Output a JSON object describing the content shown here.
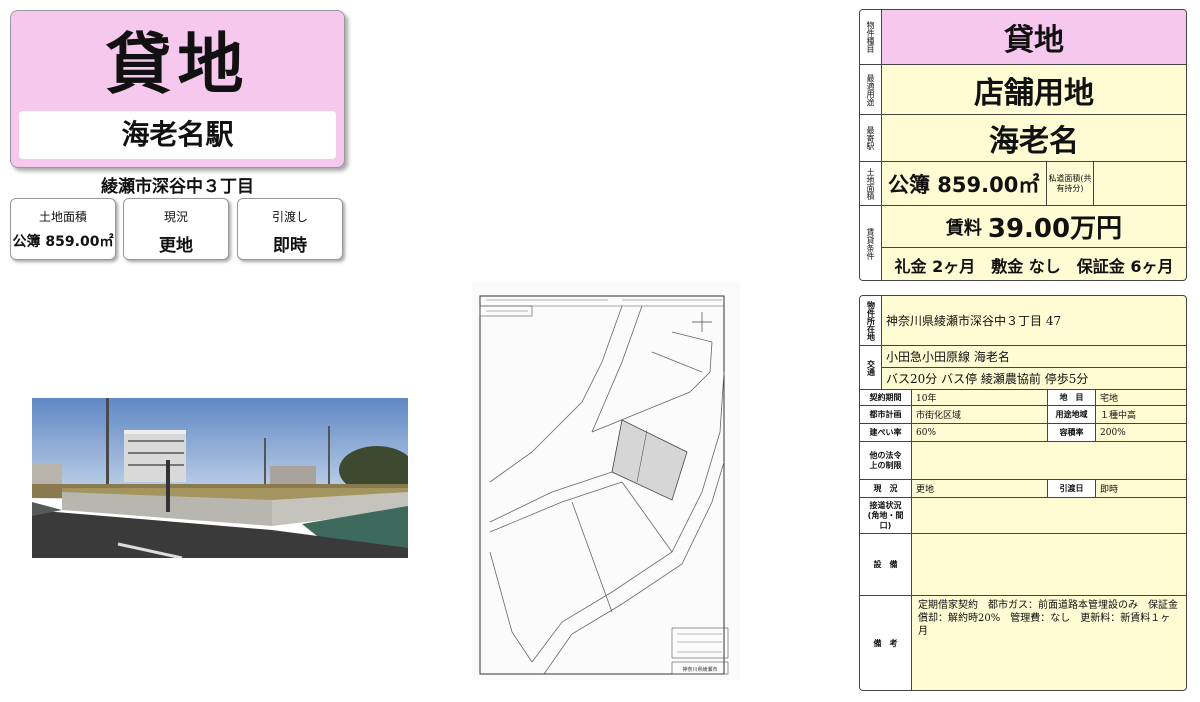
{
  "left": {
    "title": "貸地",
    "station": "海老名駅",
    "address": "綾瀬市深谷中３丁目",
    "boxes": [
      {
        "label": "土地面積",
        "value": "公簿 859.00㎡"
      },
      {
        "label": "現況",
        "value": "更地"
      },
      {
        "label": "引渡し",
        "value": "即時"
      }
    ]
  },
  "right_top": {
    "type_label": "物件種目",
    "type_value": "貸地",
    "use_label": "最適用途",
    "use_value": "店舗用地",
    "station_label": "最寄駅",
    "station_value": "海老名",
    "area_label": "土地面積",
    "area_value": "公簿 859.00㎡",
    "private_road_label": "私道面積(共有持分)",
    "terms_label": "賃貸条件",
    "rent_label": "賃料",
    "rent_value": "39.00万円",
    "fees": "礼金 2ヶ月　敷金 なし　保証金 6ヶ月"
  },
  "right_bottom": {
    "location_label": "物件所在地",
    "location_value": "神奈川県綾瀬市深谷中３丁目 47",
    "transport_label": "交通",
    "transport_line1": "小田急小田原線 海老名",
    "transport_line2": "バス20分 バス停 綾瀬農協前 停歩5分",
    "contract_label": "契約期間",
    "contract_value": "10年",
    "land_cat_label": "地　目",
    "land_cat_value": "宅地",
    "planning_label": "都市計画",
    "planning_value": "市街化区域",
    "zone_label": "用途地域",
    "zone_value": "１種中高",
    "coverage_label": "建ぺい率",
    "coverage_value": "60%",
    "far_label": "容積率",
    "far_value": "200%",
    "legal_label": "他の法令上の制限",
    "legal_value": "",
    "status_label": "現　況",
    "status_value": "更地",
    "handover_label": "引渡日",
    "handover_value": "即時",
    "access_label": "接道状況(角地・間口)",
    "access_value": "",
    "equip_label": "設　備",
    "equip_value": "",
    "notes_label": "備　考",
    "notes_value": "定期借家契約　都市ガス：前面道路本管埋設のみ　保証金償却：解約時20%　管理費：なし　更新料：新賃料１ヶ月"
  },
  "map": {
    "footer": "神奈川県綾瀬市"
  },
  "colors": {
    "pink": "#f7c8ee",
    "cream": "#fffbd2"
  }
}
